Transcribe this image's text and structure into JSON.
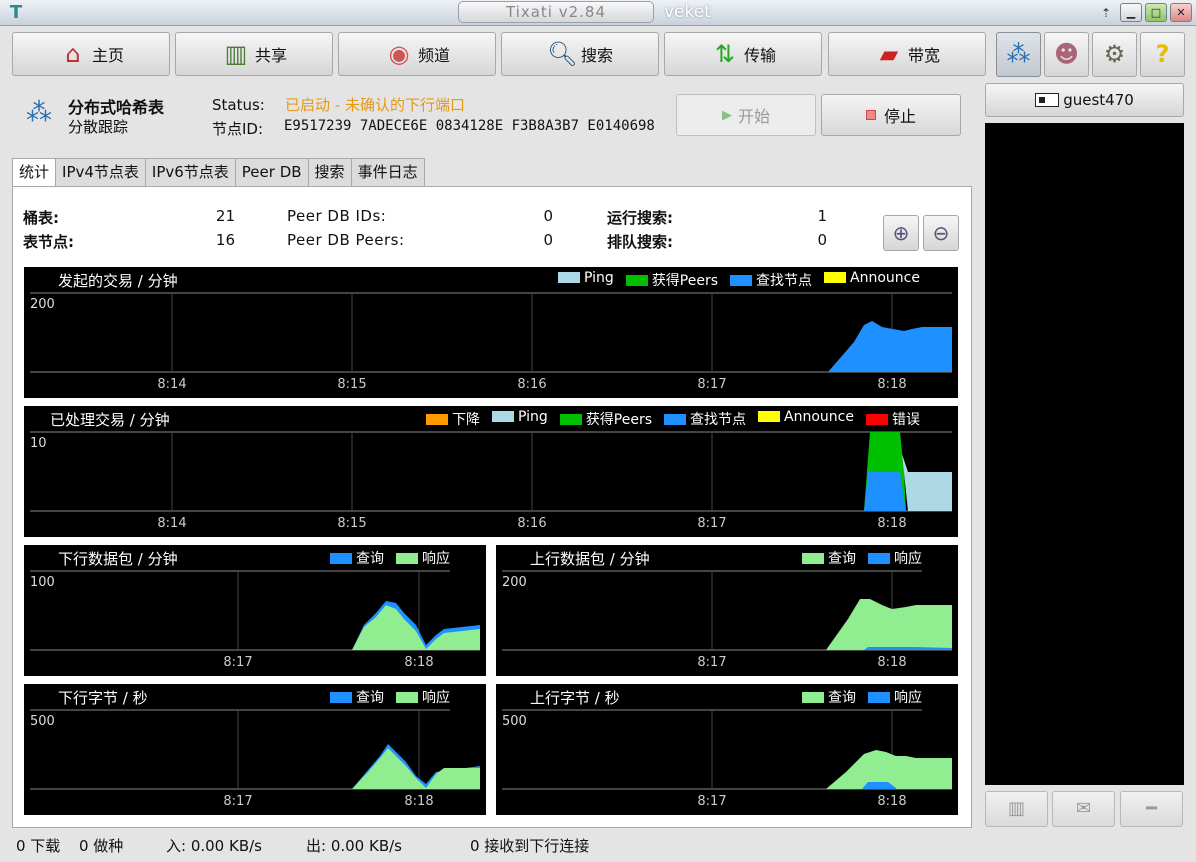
{
  "window": {
    "title": "Tixati v2.84",
    "user": "veket"
  },
  "toolbar": {
    "home": "主页",
    "share": "共享",
    "channels": "频道",
    "search": "搜索",
    "transfers": "传输",
    "bandwidth": "带宽"
  },
  "dht": {
    "title": "分布式哈希表",
    "subtitle": "分散跟踪",
    "status_label": "Status:",
    "status_value": "已启动 - 未确认的下行端口",
    "node_label": "节点ID:",
    "node_value": "E9517239 7ADECE6E 0834128E F3B8A3B7 E0140698",
    "start": "开始",
    "stop": "停止"
  },
  "tabs": [
    "统计",
    "IPv4节点表",
    "IPv6节点表",
    "Peer DB",
    "搜索",
    "事件日志"
  ],
  "stats": {
    "buckets_label": "桶表:",
    "buckets": "21",
    "nodes_label": "表节点:",
    "nodes": "16",
    "peerdb_ids_label": "Peer DB IDs:",
    "peerdb_ids": "0",
    "peerdb_peers_label": "Peer DB Peers:",
    "peerdb_peers": "0",
    "running_label": "运行搜索:",
    "running": "1",
    "queued_label": "排队搜索:",
    "queued": "0"
  },
  "graphs": {
    "initiated": {
      "title": "发起的交易 / 分钟",
      "ymax": "200",
      "legend": [
        "Ping",
        "获得Peers",
        "查找节点",
        "Announce"
      ],
      "xticks": [
        "8:14",
        "8:15",
        "8:16",
        "8:17",
        "8:18"
      ]
    },
    "processed": {
      "title": "已处理交易 / 分钟",
      "ymax": "10",
      "legend": [
        "下降",
        "Ping",
        "获得Peers",
        "查找节点",
        "Announce",
        "错误"
      ],
      "xticks": [
        "8:14",
        "8:15",
        "8:16",
        "8:17",
        "8:18"
      ]
    },
    "down_packets": {
      "title": "下行数据包 / 分钟",
      "ymax": "100",
      "legend": [
        "查询",
        "响应"
      ],
      "xticks": [
        "8:17",
        "8:18"
      ]
    },
    "up_packets": {
      "title": "上行数据包 / 分钟",
      "ymax": "200",
      "legend": [
        "查询",
        "响应"
      ],
      "xticks": [
        "8:17",
        "8:18"
      ]
    },
    "down_bytes": {
      "title": "下行字节 / 秒",
      "ymax": "500",
      "legend": [
        "查询",
        "响应"
      ],
      "xticks": [
        "8:17",
        "8:18"
      ]
    },
    "up_bytes": {
      "title": "上行字节 / 秒",
      "ymax": "500",
      "legend": [
        "查询",
        "响应"
      ],
      "xticks": [
        "8:17",
        "8:18"
      ]
    }
  },
  "colors": {
    "ping": "#add8e6",
    "get_peers": "#00c000",
    "find_node": "#1e90ff",
    "announce": "#ffff00",
    "drop": "#ff9900",
    "error": "#ff0000",
    "query": "#1e90ff",
    "response": "#90ee90",
    "status": "#e39a16"
  },
  "user": {
    "name": "guest470"
  },
  "statusbar": {
    "downloading": "0 下载",
    "seeding": "0 做种",
    "in": "入: 0.00 KB/s",
    "out": "出: 0.00 KB/s",
    "incoming": "0 接收到下行连接"
  }
}
